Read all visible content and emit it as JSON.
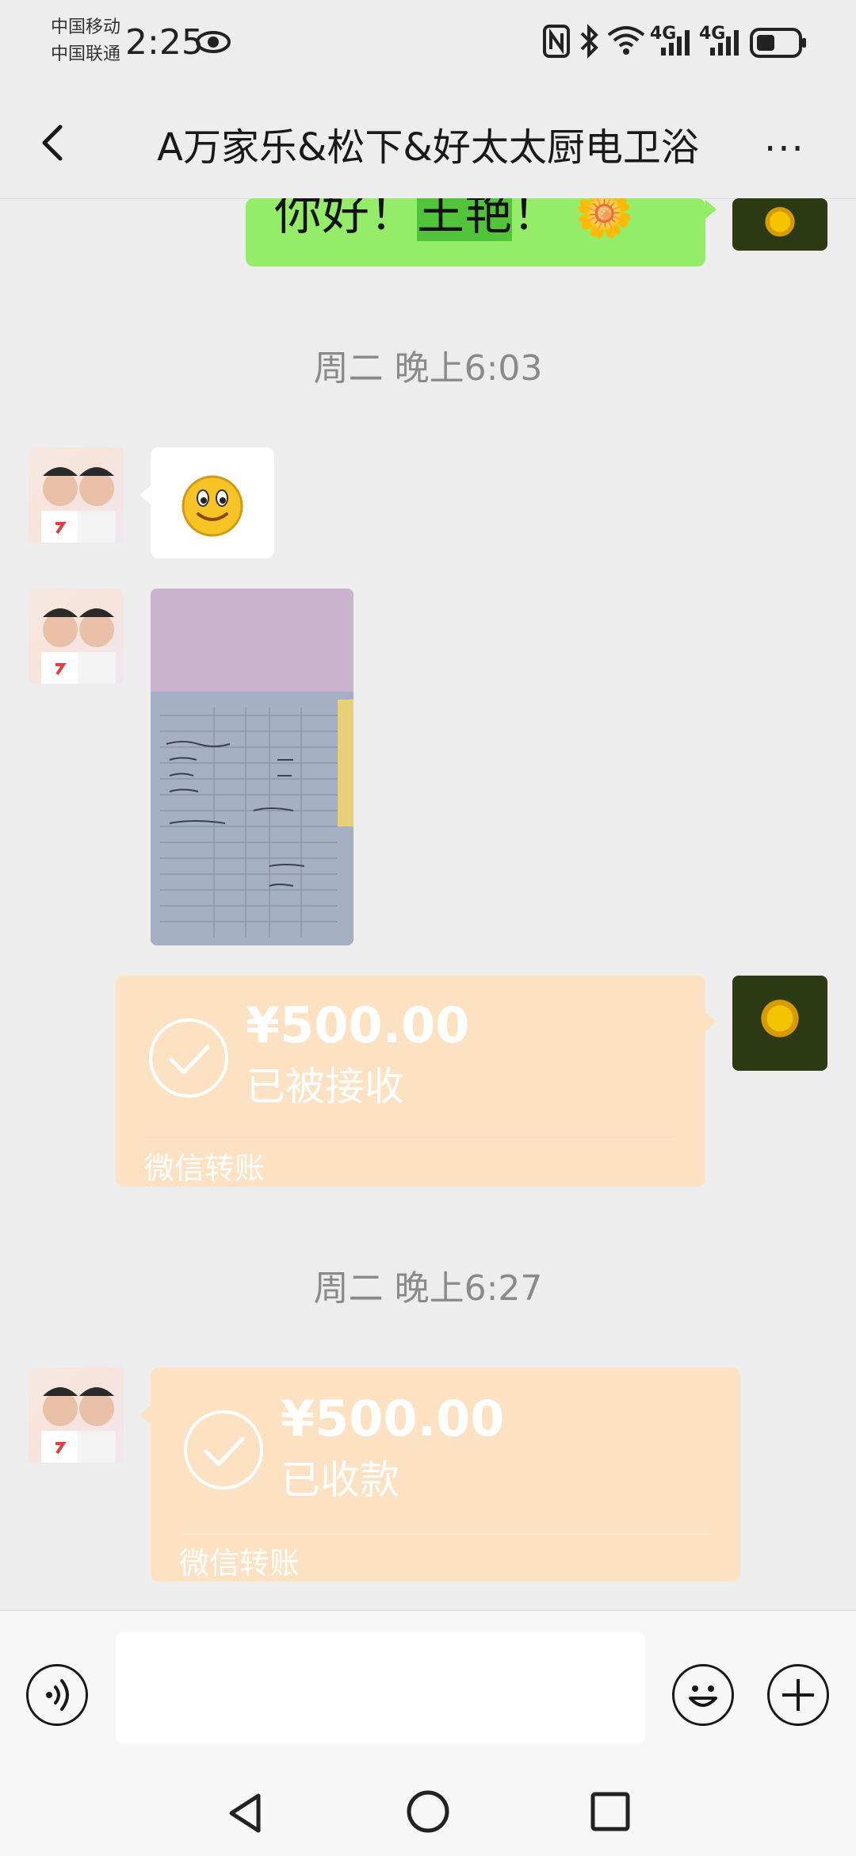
{
  "status_bar": {
    "carrier_1": "中国移动",
    "carrier_2": "中国联通",
    "time": "2:25",
    "net_1": "4G",
    "net_2": "4G"
  },
  "header": {
    "title": "A万家乐&松下&好太太厨电卫浴",
    "back_icon": "chevron-left-icon",
    "more_label": "···"
  },
  "messages": [
    {
      "type": "text",
      "side": "right",
      "text_plain_1": "你好！",
      "text_highlight": "王艳",
      "text_plain_2": "！",
      "emoji": "🌼"
    },
    {
      "type": "timestamp",
      "text": "周二 晚上6:03"
    },
    {
      "type": "emoji",
      "side": "left",
      "emoji": "🙂"
    },
    {
      "type": "image",
      "side": "left"
    },
    {
      "type": "transfer",
      "side": "right",
      "amount": "¥500.00",
      "status": "已被接收",
      "footer": "微信转账"
    },
    {
      "type": "timestamp",
      "text": "周二 晚上6:27"
    },
    {
      "type": "transfer",
      "side": "left",
      "amount": "¥500.00",
      "status": "已收款",
      "footer": "微信转账"
    }
  ],
  "colors": {
    "background": "#ededed",
    "bubble_green": "#95ec69",
    "transfer": "#fde1c3"
  }
}
